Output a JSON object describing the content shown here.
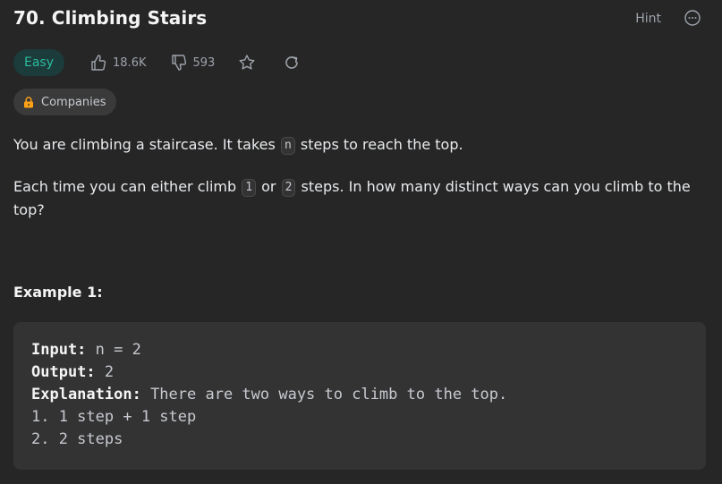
{
  "problem": {
    "title": "70. Climbing Stairs",
    "hint_label": "Hint",
    "difficulty": "Easy",
    "likes": "18.6K",
    "dislikes": "593",
    "companies_label": "Companies"
  },
  "description": {
    "p1_a": "You are climbing a staircase. It takes ",
    "p1_code": "n",
    "p1_b": " steps to reach the top.",
    "p2_a": "Each time you can either climb ",
    "p2_code1": "1",
    "p2_b": " or ",
    "p2_code2": "2",
    "p2_c": " steps. In how many distinct ways can you climb to the top?"
  },
  "example": {
    "title": "Example 1:",
    "input_label": "Input:",
    "input_value": " n = 2",
    "output_label": "Output:",
    "output_value": " 2",
    "explanation_label": "Explanation:",
    "explanation_value": " There are two ways to climb to the top.",
    "line4": "1. 1 step + 1 step",
    "line5": "2. 2 steps"
  },
  "colors": {
    "background": "#262626",
    "easy": "#2cbb9d",
    "lock": "#ffa116"
  },
  "icons": [
    "more-horizontal-icon",
    "thumbs-up-icon",
    "thumbs-down-icon",
    "star-icon",
    "share-icon",
    "lock-icon"
  ]
}
